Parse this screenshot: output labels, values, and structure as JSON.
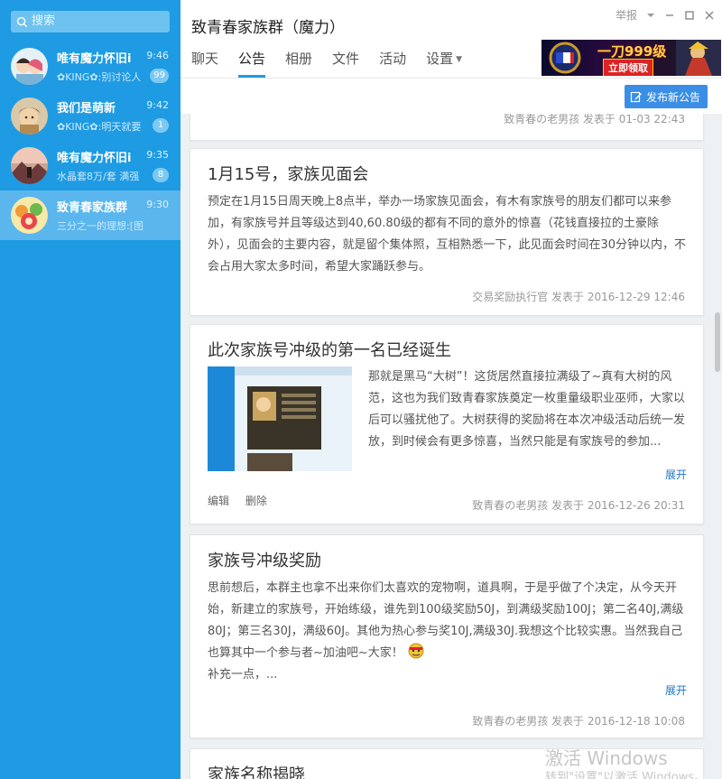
{
  "sidebar": {
    "search_placeholder": "搜索",
    "chats": [
      {
        "name": "唯有魔力怀旧i",
        "time": "9:46",
        "preview": "✿KING✿:别讨论人",
        "badge": "99"
      },
      {
        "name": "我们是萌新",
        "time": "9:42",
        "preview": "✿KING✿:明天就要",
        "badge": "1"
      },
      {
        "name": "唯有魔力怀旧i",
        "time": "9:35",
        "preview": "水晶套8万/套 满强",
        "badge": "8"
      },
      {
        "name": "致青春家族群",
        "time": "9:30",
        "preview": "三分之一的理想:[图片]",
        "badge": ""
      }
    ]
  },
  "header": {
    "title": "致青春家族群（魔力）",
    "report": "举报",
    "tabs": [
      "聊天",
      "公告",
      "相册",
      "文件",
      "活动",
      "设置"
    ],
    "active_tab": "公告",
    "ad": {
      "headline": "一刀999级",
      "button": "立即领取"
    }
  },
  "toolbar": {
    "publish_label": "发布新公告"
  },
  "feed": {
    "top_meta": "致青春の老男孩 发表于 01-03 22:43",
    "posts": [
      {
        "title": "1月15号，家族见面会",
        "body": "预定在1月15日周天晚上8点半，举办一场家族见面会，有木有家族号的朋友们都可以来参加，有家族号并且等级达到40,60.80级的都有不同的意外的惊喜（花钱直接拉的土豪除外），见面会的主要内容，就是留个集体照，互相熟悉一下，此见面会时间在30分钟以内，不会占用大家太多时间，希望大家踊跃参与。",
        "meta": "交易奖励执行官 发表于 2016-12-29 12:46"
      },
      {
        "title": "此次家族号冲级的第一名已经诞生",
        "body": "那就是黑马“大树”！这货居然直接拉满级了~真有大树的风范，这也为我们致青春家族奠定一枚重量级职业巫师，大家以后可以骚扰他了。大树获得的奖励将在本次冲级活动后统一发放，到时候会有更多惊喜，当然只能是有家族号的参加...",
        "expand": "展开",
        "actions": [
          "编辑",
          "删除"
        ],
        "meta": "致青春の老男孩 发表于 2016-12-26 20:31"
      },
      {
        "title": "家族号冲级奖励",
        "body": "思前想后，本群主也拿不出来你们太喜欢的宠物啊，道具啊，于是乎做了个决定，从今天开始，新建立的家族号，开始练级，谁先到100级奖励50J，到满级奖励100J；第二名40J,满级80J；第三名30J，满级60J。其他为热心参与奖10J,满级30J.我想这个比较实惠。当然我自己也算其中一个参与者~加油吧~大家！",
        "body_extra": "补充一点，...",
        "expand": "展开",
        "meta": "致青春の老男孩 发表于 2016-12-18 10:08"
      },
      {
        "title": "家族名称揭晓"
      }
    ]
  },
  "watermark": {
    "line1": "激活 Windows",
    "line2": "转到\"设置\"以激活 Windows。"
  }
}
